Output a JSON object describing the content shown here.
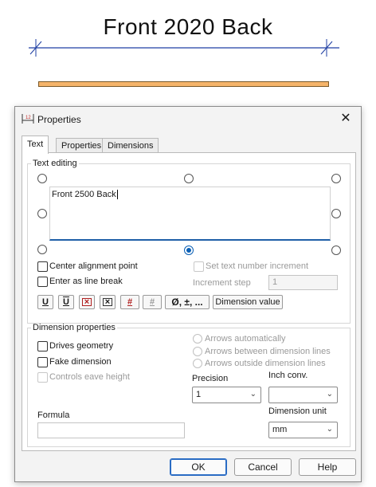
{
  "preview": {
    "dimension_text": "Front 2020 Back",
    "line_color": "#1f3fa3",
    "beam_color": "#f5b46a"
  },
  "dialog": {
    "title": "Properties",
    "close_glyph": "✕",
    "tabs": [
      {
        "label": "Text",
        "active": true
      },
      {
        "label": "Properties",
        "active": false
      },
      {
        "label": "Dimensions",
        "active": false
      }
    ],
    "text_editing": {
      "legend": "Text editing",
      "text_value": "Front 2500 Back",
      "center_alignment_label": "Center alignment point",
      "line_break_label": "Enter as line break",
      "set_increment_label": "Set text number increment",
      "increment_step_label": "Increment step",
      "increment_step_value": "1",
      "format_buttons": [
        "U",
        "U",
        "×",
        "×",
        "#",
        "#"
      ],
      "symbols_button": "Ø, ±, ...",
      "dimension_value_button": "Dimension value"
    },
    "dimension_properties": {
      "legend": "Dimension properties",
      "drives_geometry_label": "Drives geometry",
      "fake_dimension_label": "Fake dimension",
      "controls_eave_label": "Controls eave height",
      "arrows_auto_label": "Arrows automatically",
      "arrows_between_label": "Arrows between dimension lines",
      "arrows_outside_label": "Arrows outside dimension lines",
      "precision_label": "Precision",
      "precision_value": "1",
      "inch_conv_label": "Inch conv.",
      "inch_conv_value": "",
      "formula_label": "Formula",
      "formula_value": "",
      "dimension_unit_label": "Dimension unit",
      "dimension_unit_value": "mm"
    },
    "buttons": {
      "ok": "OK",
      "cancel": "Cancel",
      "help": "Help"
    }
  }
}
